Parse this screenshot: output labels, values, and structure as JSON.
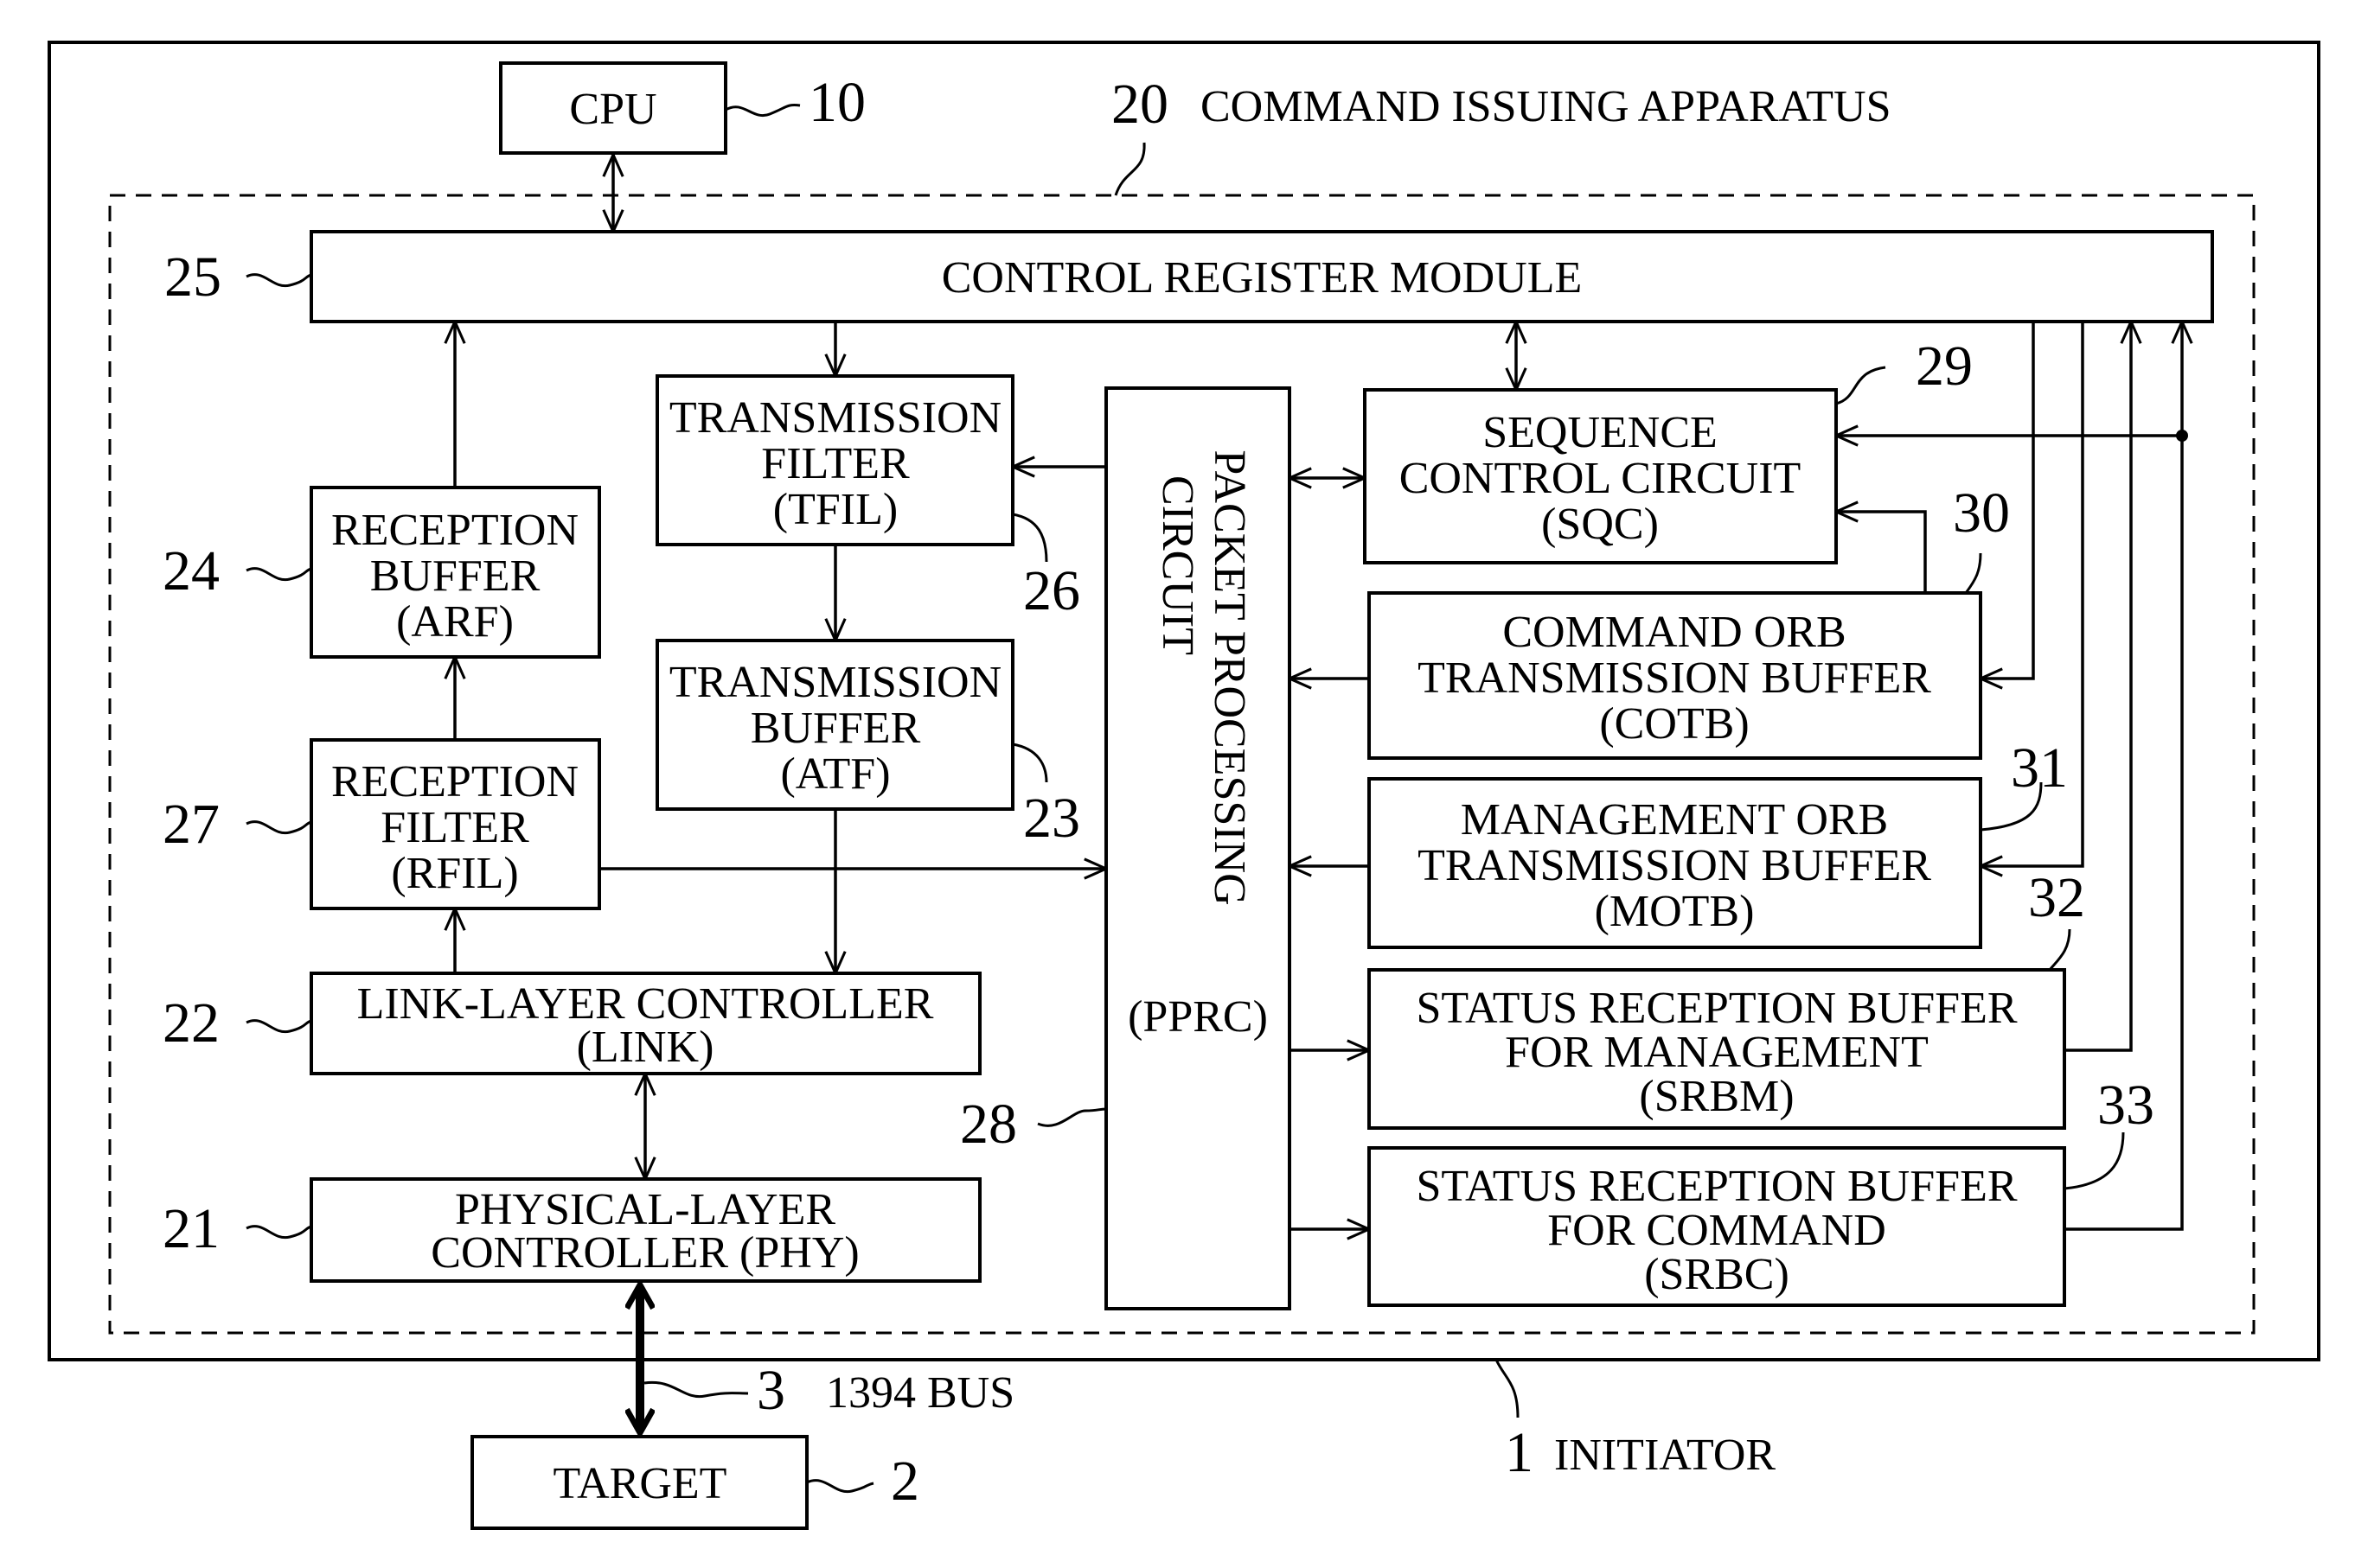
{
  "diagram": {
    "initiator": {
      "ref": "1",
      "label": "INITIATOR"
    },
    "target": {
      "ref": "2",
      "label": "TARGET"
    },
    "bus": {
      "ref": "3",
      "label": "1394 BUS"
    },
    "cpu": {
      "ref": "10",
      "label": "CPU"
    },
    "apparatus": {
      "ref": "20",
      "label": "COMMAND ISSUING APPARATUS"
    },
    "blocks": {
      "phy": {
        "ref": "21",
        "lines": [
          "PHYSICAL-LAYER",
          "CONTROLLER (PHY)"
        ]
      },
      "link": {
        "ref": "22",
        "lines": [
          "LINK-LAYER CONTROLLER",
          "(LINK)"
        ]
      },
      "atf": {
        "ref": "23",
        "lines": [
          "TRANSMISSION",
          "BUFFER",
          "(ATF)"
        ]
      },
      "arf": {
        "ref": "24",
        "lines": [
          "RECEPTION",
          "BUFFER",
          "(ARF)"
        ]
      },
      "crm": {
        "ref": "25",
        "lines": [
          "CONTROL REGISTER MODULE"
        ]
      },
      "tfil": {
        "ref": "26",
        "lines": [
          "TRANSMISSION",
          "FILTER",
          "(TFIL)"
        ]
      },
      "rfil": {
        "ref": "27",
        "lines": [
          "RECEPTION",
          "FILTER",
          "(RFIL)"
        ]
      },
      "pprc": {
        "ref": "28",
        "lines": [
          "PACKET PROCESSING",
          "CIRCUIT",
          "(PPRC)"
        ]
      },
      "sqc": {
        "ref": "29",
        "lines": [
          "SEQUENCE",
          "CONTROL CIRCUIT",
          "(SQC)"
        ]
      },
      "cotb": {
        "ref": "30",
        "lines": [
          "COMMAND ORB",
          "TRANSMISSION BUFFER",
          "(COTB)"
        ]
      },
      "motb": {
        "ref": "31",
        "lines": [
          "MANAGEMENT ORB",
          "TRANSMISSION BUFFER",
          "(MOTB)"
        ]
      },
      "srbm": {
        "ref": "32",
        "lines": [
          "STATUS RECEPTION BUFFER",
          "FOR MANAGEMENT",
          "(SRBM)"
        ]
      },
      "srbc": {
        "ref": "33",
        "lines": [
          "STATUS RECEPTION BUFFER",
          "FOR COMMAND",
          "(SRBC)"
        ]
      }
    }
  }
}
